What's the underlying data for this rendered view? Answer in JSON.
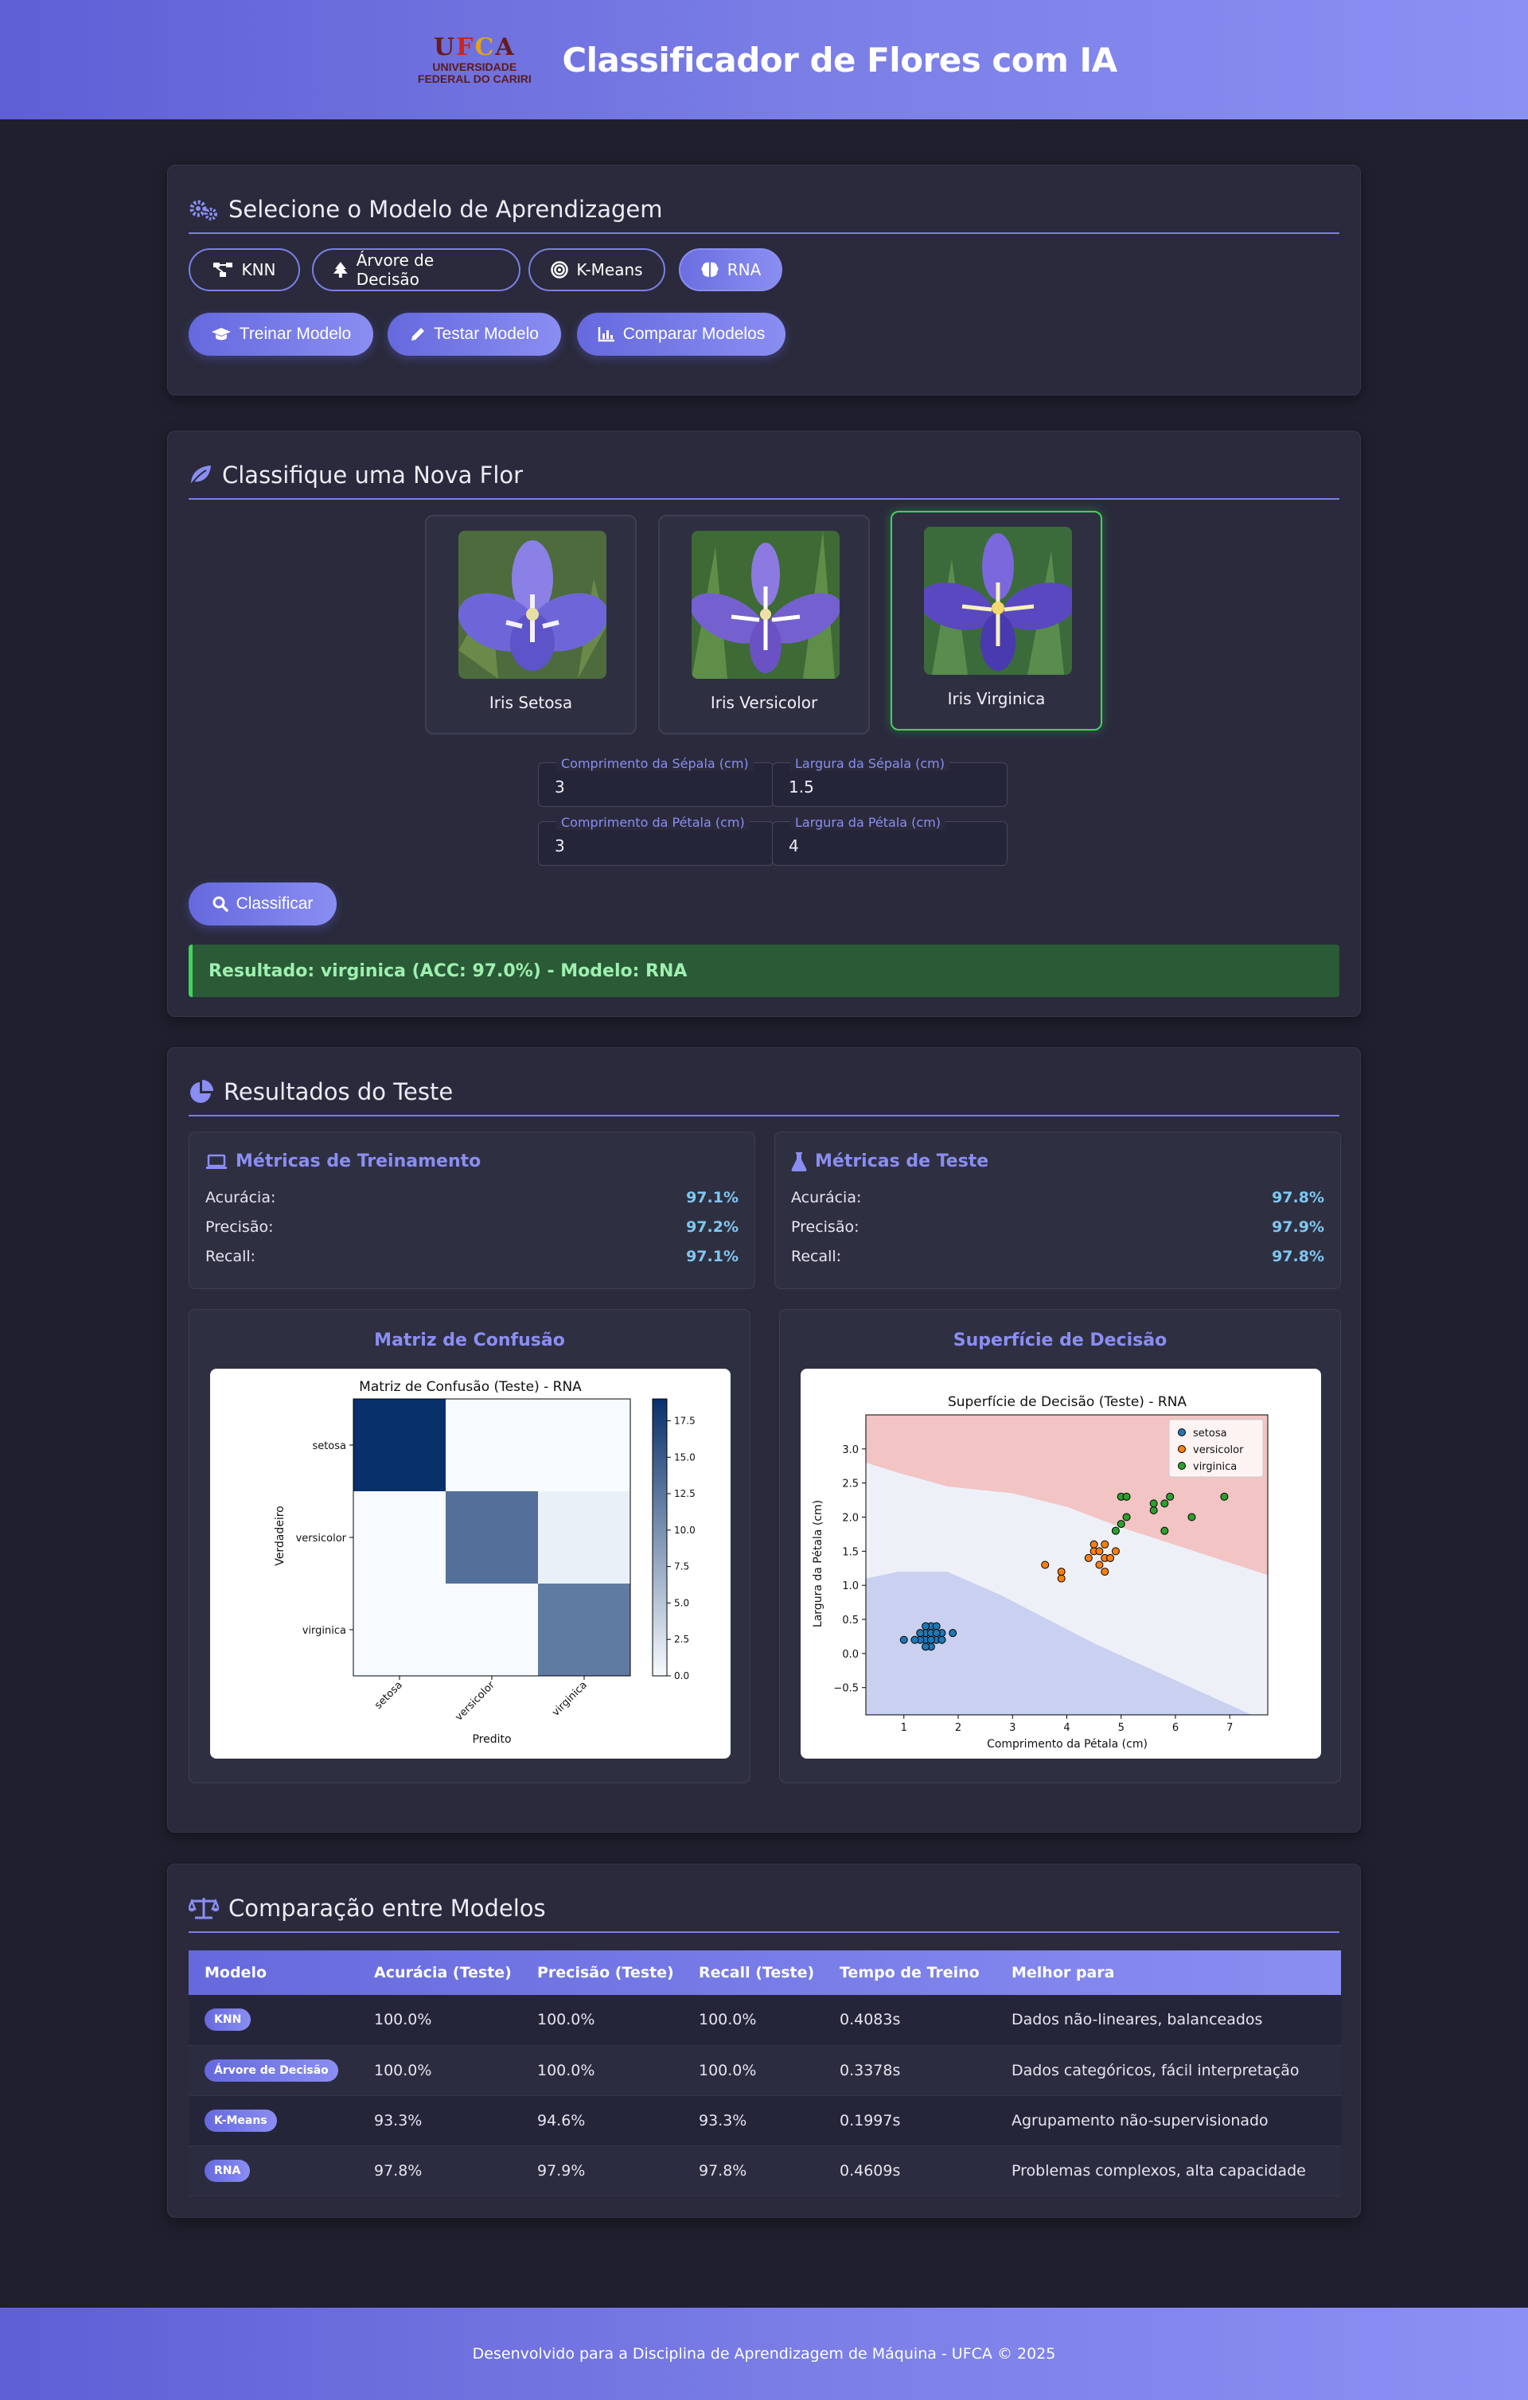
{
  "header": {
    "logo_mark": "UFCA",
    "logo_line1": "UNIVERSIDADE",
    "logo_line2": "FEDERAL DO CARIRI",
    "title": "Classificador de Flores com IA"
  },
  "model_panel": {
    "title": "Selecione o Modelo de Aprendizagem",
    "models": [
      {
        "label": "KNN",
        "icon": "project-diagram-icon",
        "active": false
      },
      {
        "label": "Árvore de Decisão",
        "icon": "tree-icon",
        "active": false
      },
      {
        "label": "K-Means",
        "icon": "bullseye-icon",
        "active": false
      },
      {
        "label": "RNA",
        "icon": "brain-icon",
        "active": true
      }
    ],
    "actions": [
      {
        "label": "Treinar Modelo",
        "icon": "graduation-cap-icon"
      },
      {
        "label": "Testar Modelo",
        "icon": "pencil-icon"
      },
      {
        "label": "Comparar Modelos",
        "icon": "chart-icon"
      }
    ]
  },
  "classify_panel": {
    "title": "Classifique uma Nova Flor",
    "flowers": [
      {
        "label": "Iris Setosa",
        "selected": false
      },
      {
        "label": "Iris Versicolor",
        "selected": false
      },
      {
        "label": "Iris Virginica",
        "selected": true
      }
    ],
    "fields": [
      {
        "label": "Comprimento da Sépala (cm)",
        "value": "3"
      },
      {
        "label": "Largura da Sépala (cm)",
        "value": "1.5"
      },
      {
        "label": "Comprimento da Pétala (cm)",
        "value": "3"
      },
      {
        "label": "Largura da Pétala (cm)",
        "value": "4"
      }
    ],
    "classify_label": "Classificar",
    "result": "Resultado: virginica (ACC: 97.0%) - Modelo: RNA"
  },
  "results_panel": {
    "title": "Resultados do Teste",
    "train": {
      "title": "Métricas de Treinamento",
      "rows": [
        {
          "label": "Acurácia:",
          "value": "97.1%"
        },
        {
          "label": "Precisão:",
          "value": "97.2%"
        },
        {
          "label": "Recall:",
          "value": "97.1%"
        }
      ]
    },
    "test": {
      "title": "Métricas de Teste",
      "rows": [
        {
          "label": "Acurácia:",
          "value": "97.8%"
        },
        {
          "label": "Precisão:",
          "value": "97.9%"
        },
        {
          "label": "Recall:",
          "value": "97.8%"
        }
      ]
    },
    "confusion_card_title": "Matriz de Confusão",
    "surface_card_title": "Superfície de Decisão"
  },
  "chart_data": [
    {
      "type": "heatmap",
      "title": "Matriz de Confusão (Teste) - RNA",
      "xlabel": "Predito",
      "ylabel": "Verdadeiro",
      "x_categories": [
        "setosa",
        "versicolor",
        "virginica"
      ],
      "y_categories": [
        "setosa",
        "versicolor",
        "virginica"
      ],
      "values": [
        [
          19,
          0,
          0
        ],
        [
          0,
          13,
          1
        ],
        [
          0,
          0,
          12
        ]
      ],
      "colorbar_ticks": [
        "0.0",
        "2.5",
        "5.0",
        "7.5",
        "10.0",
        "12.5",
        "15.0",
        "17.5"
      ],
      "colormap": "Blues",
      "vmin": 0,
      "vmax": 19
    },
    {
      "type": "scatter",
      "title": "Superfície de Decisão (Teste) - RNA",
      "xlabel": "Comprimento da Pétala (cm)",
      "ylabel": "Largura da Pétala (cm)",
      "xlim": [
        0.3,
        7.7
      ],
      "ylim": [
        -0.9,
        3.5
      ],
      "x_ticks": [
        1,
        2,
        3,
        4,
        5,
        6,
        7
      ],
      "y_ticks": [
        "-0.5",
        "0.0",
        "0.5",
        "1.0",
        "1.5",
        "2.0",
        "2.5",
        "3.0"
      ],
      "legend_position": "top-right",
      "regions": [
        {
          "class": "setosa",
          "color": "#c9d0f0"
        },
        {
          "class": "versicolor",
          "color": "#eef0f8"
        },
        {
          "class": "virginica",
          "color": "#f2c4c4"
        }
      ],
      "series": [
        {
          "name": "setosa",
          "color": "#1f77b4",
          "points": [
            [
              1.4,
              0.2
            ],
            [
              1.5,
              0.2
            ],
            [
              1.3,
              0.2
            ],
            [
              1.6,
              0.2
            ],
            [
              1.4,
              0.3
            ],
            [
              1.5,
              0.4
            ],
            [
              1.7,
              0.3
            ],
            [
              1.5,
              0.1
            ],
            [
              1.4,
              0.1
            ],
            [
              1.6,
              0.4
            ],
            [
              1.3,
              0.3
            ],
            [
              1.2,
              0.2
            ],
            [
              1.9,
              0.3
            ],
            [
              1.0,
              0.2
            ],
            [
              1.5,
              0.3
            ],
            [
              1.7,
              0.2
            ],
            [
              1.6,
              0.3
            ],
            [
              1.4,
              0.4
            ],
            [
              1.5,
              0.2
            ]
          ]
        },
        {
          "name": "versicolor",
          "color": "#ff7f0e",
          "points": [
            [
              3.6,
              1.3
            ],
            [
              3.9,
              1.1
            ],
            [
              3.9,
              1.2
            ],
            [
              4.4,
              1.4
            ],
            [
              4.5,
              1.5
            ],
            [
              4.5,
              1.6
            ],
            [
              4.6,
              1.3
            ],
            [
              4.7,
              1.4
            ],
            [
              4.7,
              1.6
            ],
            [
              4.6,
              1.5
            ],
            [
              4.8,
              1.4
            ],
            [
              4.7,
              1.2
            ],
            [
              4.9,
              1.5
            ]
          ]
        },
        {
          "name": "virginica",
          "color": "#2ca02c",
          "points": [
            [
              4.9,
              1.8
            ],
            [
              5.0,
              1.9
            ],
            [
              5.1,
              2.0
            ],
            [
              5.0,
              2.3
            ],
            [
              5.1,
              2.3
            ],
            [
              5.6,
              2.1
            ],
            [
              5.6,
              2.2
            ],
            [
              5.8,
              2.2
            ],
            [
              5.9,
              2.3
            ],
            [
              5.8,
              1.8
            ],
            [
              6.3,
              2.0
            ],
            [
              6.9,
              2.3
            ]
          ]
        }
      ]
    }
  ],
  "comparison_panel": {
    "title": "Comparação entre Modelos",
    "headers": [
      "Modelo",
      "Acurácia (Teste)",
      "Precisão (Teste)",
      "Recall (Teste)",
      "Tempo de Treino",
      "Melhor para"
    ],
    "rows": [
      {
        "model": "KNN",
        "acc": "100.0%",
        "prec": "100.0%",
        "rec": "100.0%",
        "time": "0.4083s",
        "best": "Dados não-lineares, balanceados"
      },
      {
        "model": "Árvore de Decisão",
        "acc": "100.0%",
        "prec": "100.0%",
        "rec": "100.0%",
        "time": "0.3378s",
        "best": "Dados categóricos, fácil interpretação"
      },
      {
        "model": "K-Means",
        "acc": "93.3%",
        "prec": "94.6%",
        "rec": "93.3%",
        "time": "0.1997s",
        "best": "Agrupamento não-supervisionado"
      },
      {
        "model": "RNA",
        "acc": "97.8%",
        "prec": "97.9%",
        "rec": "97.8%",
        "time": "0.4609s",
        "best": "Problemas complexos, alta capacidade"
      }
    ]
  },
  "footer": {
    "text": "Desenvolvido para a Disciplina de Aprendizagem de Máquina - UFCA © 2025"
  },
  "colors": {
    "accent": "#7b7fe6",
    "panel_bg": "#2a2a3c",
    "page_bg": "#1f1f2e",
    "success": "#3fd45a"
  }
}
